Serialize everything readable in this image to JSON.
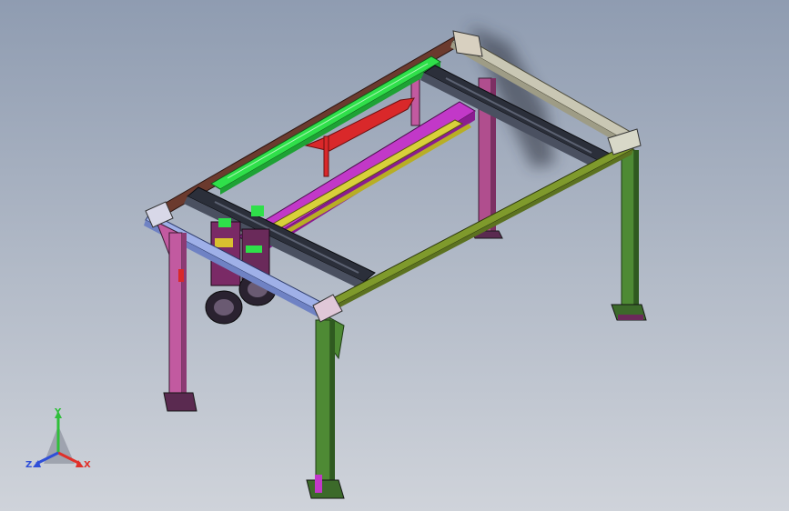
{
  "viewport": {
    "background_top": "#8f9cb1",
    "background_bottom": "#cfd3da"
  },
  "model": {
    "type": "gantry-frame-assembly",
    "colors": {
      "rear_beam": "#6b3a2e",
      "front_left_beam": "#9fb0e8",
      "front_right_beam": "#7f9a2c",
      "right_beam": "#c9c7b4",
      "green_rail": "#2fe04a",
      "magenta_rail": "#c238c8",
      "yellow_rail": "#d8d03a",
      "cross_beam": "#2b2f3a",
      "leg_pink": "#c25aa0",
      "leg_green": "#4e8a34",
      "red_brace": "#d9282a"
    }
  },
  "triad": {
    "x_label": "X",
    "y_label": "Y",
    "z_label": "Z",
    "x_color": "#e0302a",
    "y_color": "#2fbf3a",
    "z_color": "#2f4fd8"
  }
}
